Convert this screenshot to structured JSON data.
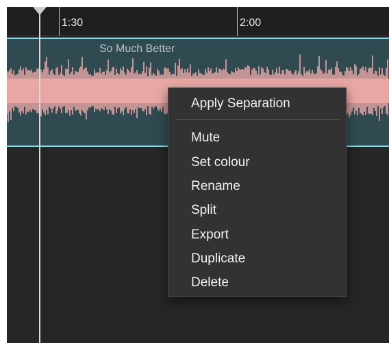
{
  "timeline": {
    "ruler_labels": [
      "1:30",
      "2:00"
    ]
  },
  "clip": {
    "name": "So Much Better",
    "track_color": "#2f4a51",
    "waveform_color": "#e8a7a5",
    "outline_color": "#7fe3ea"
  },
  "context_menu": {
    "primary_items": [
      "Apply Separation"
    ],
    "items": [
      "Mute",
      "Set colour",
      "Rename",
      "Split",
      "Export",
      "Duplicate",
      "Delete"
    ]
  }
}
